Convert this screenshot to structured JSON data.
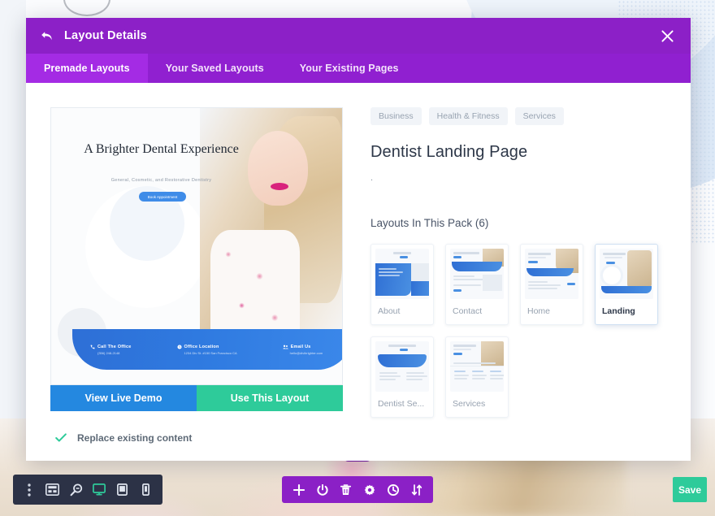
{
  "modal": {
    "title": "Layout Details",
    "back_icon": "back-arrow-icon",
    "close_icon": "close-icon",
    "tabs": [
      {
        "label": "Premade Layouts",
        "active": true
      },
      {
        "label": "Your Saved Layouts",
        "active": false
      },
      {
        "label": "Your Existing Pages",
        "active": false
      }
    ]
  },
  "preview": {
    "hero_title": "A Brighter Dental Experience",
    "hero_subtitle": "General, Cosmetic, and Restorative Dentistry",
    "hero_button": "Book Appointment",
    "contact": [
      {
        "label": "Call The Office",
        "value": "(356) 248-2148",
        "icon": "phone-icon"
      },
      {
        "label": "Office Location",
        "value": "1234 Div St. #150 San Francisco CA",
        "icon": "clock-icon"
      },
      {
        "label": "Email Us",
        "value": "hello@divibrighter.com",
        "icon": "users-icon"
      }
    ],
    "cta_demo": "View Live Demo",
    "cta_use": "Use This Layout",
    "replace_label": "Replace existing content",
    "replace_checked": true,
    "check_icon": "check-icon"
  },
  "details": {
    "tags": [
      "Business",
      "Health & Fitness",
      "Services"
    ],
    "pack_title": "Dentist Landing Page",
    "pack_description": ".",
    "layouts_heading": "Layouts In This Pack (6)",
    "layouts": [
      {
        "name": "About",
        "active": false,
        "style": "about"
      },
      {
        "name": "Contact",
        "active": false,
        "style": "contact"
      },
      {
        "name": "Home",
        "active": false,
        "style": "home"
      },
      {
        "name": "Landing",
        "active": true,
        "style": "landing"
      },
      {
        "name": "Dentist Se...",
        "active": false,
        "style": "dentist"
      },
      {
        "name": "Services",
        "active": false,
        "style": "services"
      }
    ]
  },
  "bottom_bar": {
    "dark_tools": [
      {
        "icon": "vertical-dots-icon",
        "name": "more-options",
        "active": false
      },
      {
        "icon": "wireframe-icon",
        "name": "wireframe-view",
        "active": false
      },
      {
        "icon": "zoom-icon",
        "name": "zoom-view",
        "active": false
      },
      {
        "icon": "desktop-icon",
        "name": "desktop-view",
        "active": true
      },
      {
        "icon": "tablet-icon",
        "name": "tablet-view",
        "active": false
      },
      {
        "icon": "phone-icon",
        "name": "phone-view",
        "active": false
      }
    ],
    "purple_tools": [
      {
        "icon": "plus-icon",
        "name": "add-section"
      },
      {
        "icon": "power-icon",
        "name": "toggle-builder"
      },
      {
        "icon": "trash-icon",
        "name": "delete"
      },
      {
        "icon": "gear-icon",
        "name": "settings"
      },
      {
        "icon": "history-icon",
        "name": "editing-history"
      },
      {
        "icon": "sort-arrows-icon",
        "name": "portability"
      }
    ],
    "save_label": "Save"
  },
  "colors": {
    "header_purple": "#8C20C7",
    "tab_purple": "#9020D0",
    "tab_active_purple": "#A42BE4",
    "demo_blue": "#2488E0",
    "use_green": "#2ECB9A",
    "toolbar_dark": "#2C3246",
    "active_teal": "#2ECB9A"
  }
}
